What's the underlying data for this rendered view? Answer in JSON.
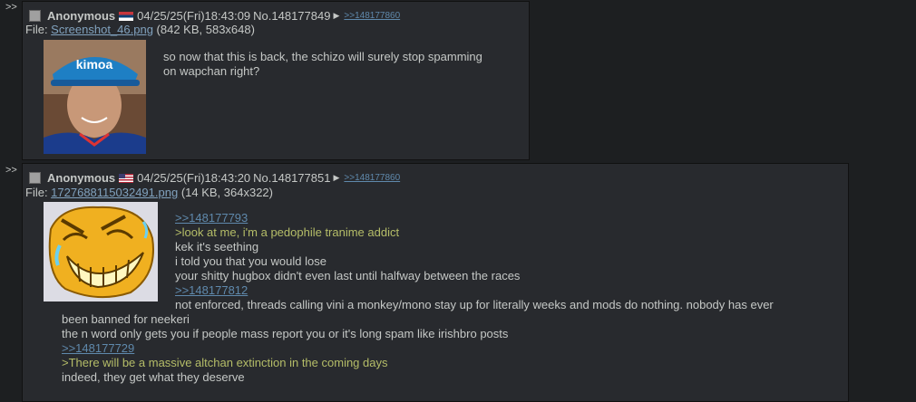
{
  "arrows": ">>",
  "posts": [
    {
      "name": "Anonymous",
      "datetime": "04/25/25(Fri)18:43:09",
      "no": "No.148177849",
      "backlink": ">>148177860",
      "file_label": "File: ",
      "file_name": "Screenshot_46.png",
      "file_info": " (842 KB, 583x648)",
      "message": [
        "so now that this is back, the schizo will surely stop spamming",
        "on wapchan right?"
      ]
    },
    {
      "name": "Anonymous",
      "datetime": "04/25/25(Fri)18:43:20",
      "no": "No.148177851",
      "backlink": ">>148177860",
      "file_label": "File: ",
      "file_name": "1727688115032491.png",
      "file_info": " (14 KB, 364x322)",
      "lines": [
        ">>148177793",
        ">look at me, i'm a pedophile tranime addict",
        "kek it's seething",
        "i told you that you would lose",
        "your shitty hugbox didn't even last until halfway between the races",
        ">>148177812",
        "not enforced, threads calling vini a monkey/mono stay up for literally weeks and mods do nothing. nobody has ever",
        "been banned for neekeri",
        "the n word only gets you if people mass report you or it's long spam like irishbro posts",
        ">>148177729",
        ">There will be a massive altchan extinction in the coming days",
        "indeed, they get what they deserve"
      ]
    }
  ],
  "colors": {
    "bg": "#1d1f21",
    "post_bg": "#282a2e",
    "quote": "#b5bd68",
    "link": "#5f89ac"
  }
}
